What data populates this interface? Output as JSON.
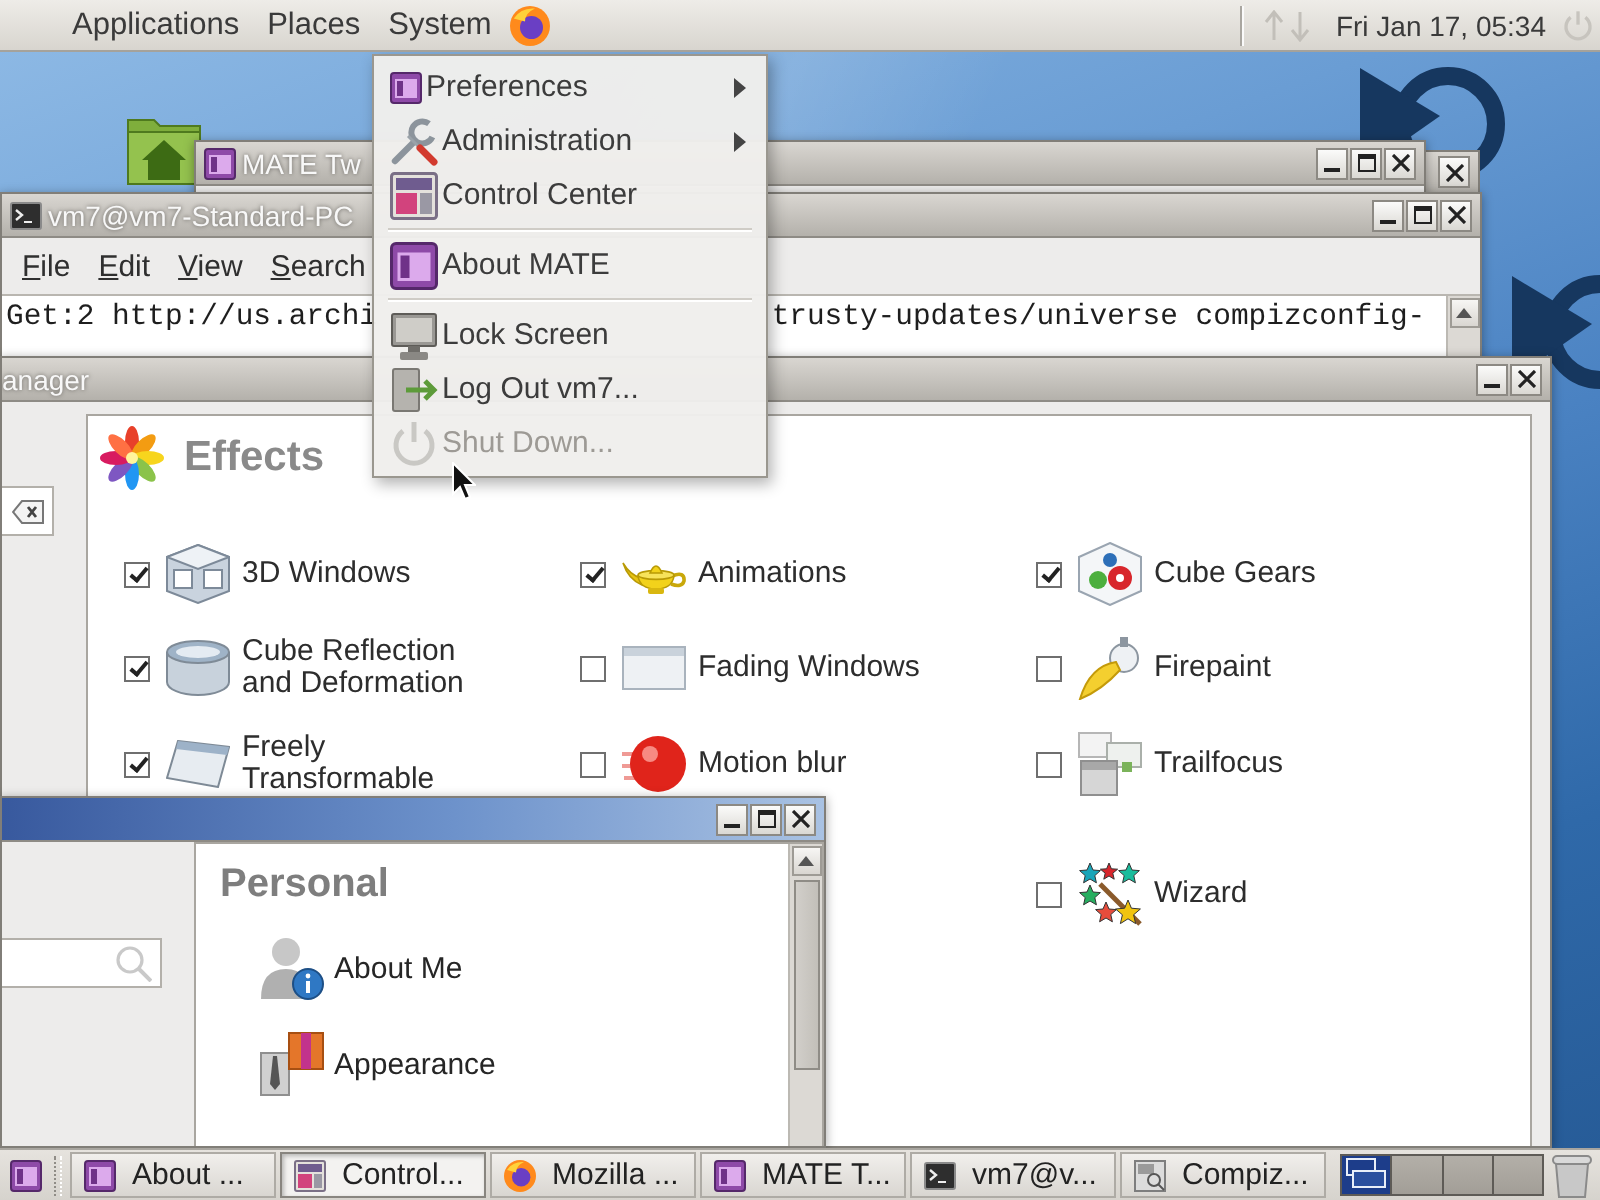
{
  "top_panel": {
    "menus": [
      "Applications",
      "Places",
      "System"
    ],
    "clock": "Fri Jan 17, 05:34"
  },
  "mate_tweak_window": {
    "title": "MATE Tw"
  },
  "terminal_window": {
    "title": "vm7@vm7-Standard-PC",
    "menu": [
      "File",
      "Edit",
      "View",
      "Search"
    ],
    "output_fragments": [
      "Get:2 http://us.archi",
      "trusty-updates/universe compizconfig-"
    ]
  },
  "ccsm_window": {
    "title": "anager",
    "category": "Effects",
    "effect_columns": [
      [
        {
          "label": "3D Windows",
          "checked": true
        },
        {
          "label": "Cube Reflection and Deformation",
          "checked": true
        },
        {
          "label": "Freely Transformable",
          "checked": true
        }
      ],
      [
        {
          "label": "Animations",
          "checked": true
        },
        {
          "label": "Fading Windows",
          "checked": false
        },
        {
          "label": "Motion blur",
          "checked": false
        }
      ],
      [
        {
          "label": "Cube Gears",
          "checked": true
        },
        {
          "label": "Firepaint",
          "checked": false
        },
        {
          "label": "Trailfocus",
          "checked": false
        },
        {
          "label": "Wizard",
          "checked": false
        }
      ]
    ]
  },
  "control_center_window": {
    "section": "Personal",
    "items": [
      "About Me",
      "Appearance"
    ]
  },
  "system_menu": {
    "items": [
      {
        "kind": "item",
        "label": "Preferences",
        "submenu": true,
        "disabled": false
      },
      {
        "kind": "item",
        "label": "Administration",
        "submenu": true,
        "disabled": false
      },
      {
        "kind": "item",
        "label": "Control Center",
        "submenu": false,
        "disabled": false
      },
      {
        "kind": "separator"
      },
      {
        "kind": "item",
        "label": "About MATE",
        "submenu": false,
        "disabled": false
      },
      {
        "kind": "separator"
      },
      {
        "kind": "item",
        "label": "Lock Screen",
        "submenu": false,
        "disabled": false
      },
      {
        "kind": "item",
        "label": "Log Out vm7...",
        "submenu": false,
        "disabled": false
      },
      {
        "kind": "item",
        "label": "Shut Down...",
        "submenu": false,
        "disabled": true
      }
    ]
  },
  "taskbar": {
    "items": [
      {
        "label": "About ...",
        "selected": false
      },
      {
        "label": "Control...",
        "selected": true
      },
      {
        "label": "Mozilla ...",
        "selected": false
      },
      {
        "label": "MATE T...",
        "selected": false
      },
      {
        "label": "vm7@v...",
        "selected": false
      },
      {
        "label": "Compiz...",
        "selected": false
      }
    ],
    "workspaces": [
      {
        "selected": true
      },
      {
        "selected": false
      },
      {
        "selected": false
      },
      {
        "selected": false
      }
    ]
  }
}
